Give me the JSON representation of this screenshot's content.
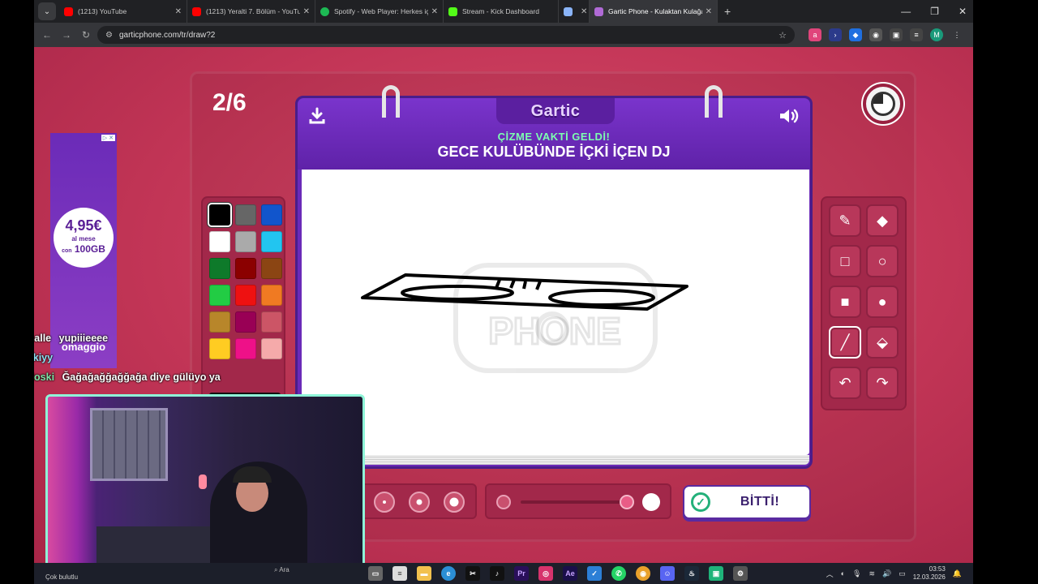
{
  "browser": {
    "tabs": [
      {
        "title": "(1213) YouTube",
        "color": "#ff0000",
        "active": false
      },
      {
        "title": "(1213) Yeralti 7. Bölüm - YouTube",
        "color": "#ff0000",
        "active": false
      },
      {
        "title": "Spotify - Web Player: Herkes için",
        "color": "#1db954",
        "active": false
      },
      {
        "title": "Stream - Kick Dashboard",
        "color": "#53fc18",
        "active": false
      },
      {
        "title": "",
        "color": "#8ab4f8",
        "active": false
      },
      {
        "title": "Gartic Phone - Kulaktan Kulağa",
        "color": "#b06ad6",
        "active": true
      }
    ],
    "url": "garticphone.com/tr/draw?2"
  },
  "game": {
    "round": "2/6",
    "logo": "Gartic",
    "prompt_label": "ÇİZME VAKTİ GELDİ!",
    "prompt_text": "GECE KULÜBÜNDE İÇKİ İÇEN DJ",
    "done_label": "BİTTİ!",
    "watermark": "PHONE",
    "palette": [
      "#000000",
      "#666666",
      "#1155cc",
      "#ffffff",
      "#aaaaaa",
      "#22c5f0",
      "#0e7a2a",
      "#8b0000",
      "#8b4513",
      "#22cc44",
      "#ee1111",
      "#f07a22",
      "#b8862a",
      "#990055",
      "#cc5566",
      "#ffcc22",
      "#ee1188",
      "#f5aaaa"
    ],
    "selected_color": "#000000",
    "opacity": 1.0
  },
  "ad": {
    "price": "4,95€",
    "per": "al mese",
    "data_prefix": "con",
    "data": "100GB",
    "tail": "omaggio"
  },
  "chat": [
    {
      "user": "hasbihalle",
      "text": "yupiiieeee",
      "user_color": "#ffffff"
    },
    {
      "user": "otakiyy",
      "text": "",
      "user_color": "#8fe3f5"
    },
    {
      "user": "aTiipoloski",
      "text": "Ğağağağğağğağa diye gülüyo ya",
      "user_color": "#7fe6a8"
    }
  ],
  "taskbar": {
    "weather": "Çok bulutlu",
    "search": "Ara",
    "time": "03:53",
    "date": "12.03.2026"
  }
}
